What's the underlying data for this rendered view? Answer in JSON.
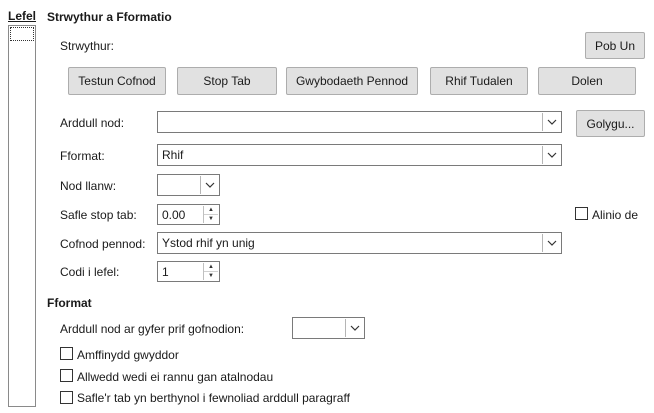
{
  "levels_panel": {
    "title": "Lefel",
    "selected": ""
  },
  "structure": {
    "title": "Strwythur a Fformatio",
    "structure_label": "Strwythur:",
    "all_button": "Pob Un",
    "buttons": {
      "entry_text": "Testun Cofnod",
      "tab_stop": "Stop Tab",
      "chapter_info": "Gwybodaeth Pennod",
      "page_number": "Rhif Tudalen",
      "hyperlink": "Dolen"
    }
  },
  "fields": {
    "char_style_label": "Arddull nod:",
    "char_style_value": "",
    "edit_button": "Golygu...",
    "format_label": "Fformat:",
    "format_value": "Rhif",
    "fill_char_label": "Nod llanw:",
    "fill_char_value": "",
    "tab_pos_label": "Safle stop tab:",
    "tab_pos_value": "0.00",
    "align_right_label": "Alinio de",
    "chapter_entry_label": "Cofnod pennod:",
    "chapter_entry_value": "Ystod rhif yn unig",
    "eval_level_label": "Codi i lefel:",
    "eval_level_value": "1"
  },
  "format": {
    "title": "Fformat",
    "main_entry_style_label": "Arddull nod ar gyfer prif gofnodion:",
    "main_entry_style_value": "",
    "alpha_delim_label": "Amffinydd gwyddor",
    "key_separate_label": "Allwedd wedi ei rannu gan atalnodau",
    "tab_relative_label": "Safle'r tab yn berthynol i fewnoliad arddull paragraff"
  }
}
